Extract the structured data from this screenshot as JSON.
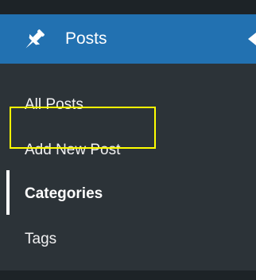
{
  "menu": {
    "title": "Posts",
    "icon": "pushpin-icon",
    "accent_color": "#2271b1",
    "submenu_bg": "#2c3338",
    "items": [
      {
        "label": "All Posts",
        "current": false
      },
      {
        "label": "Add New Post",
        "current": false
      },
      {
        "label": "Categories",
        "current": true
      },
      {
        "label": "Tags",
        "current": false
      }
    ]
  },
  "highlight_color": "#ffff00"
}
